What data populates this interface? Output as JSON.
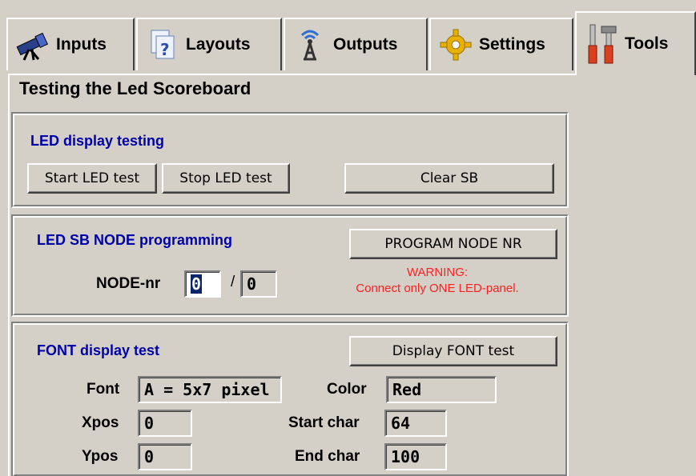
{
  "tabs": [
    {
      "label": "Inputs",
      "icon": "telescope-icon"
    },
    {
      "label": "Layouts",
      "icon": "help-pages-icon"
    },
    {
      "label": "Outputs",
      "icon": "antenna-icon"
    },
    {
      "label": "Settings",
      "icon": "gear-icon"
    },
    {
      "label": "Tools",
      "icon": "tools-icon"
    }
  ],
  "active_tab": "Tools",
  "page_title": "Testing the Led Scoreboard",
  "led_test": {
    "title": "LED display testing",
    "start_label": "Start LED test",
    "stop_label": "Stop LED test",
    "clear_label": "Clear SB"
  },
  "node_prog": {
    "title": "LED SB NODE programming",
    "program_label": "PROGRAM NODE NR",
    "node_label": "NODE-nr",
    "node_value": "0",
    "separator": "/",
    "node_total": "0",
    "warning_line1": "WARNING:",
    "warning_line2": "Connect only ONE LED-panel."
  },
  "font_test": {
    "title": "FONT display test",
    "display_label": "Display FONT test",
    "font_label": "Font",
    "font_value": "A = 5x7 pixel",
    "color_label": "Color",
    "color_value": "Red",
    "xpos_label": "Xpos",
    "xpos_value": "0",
    "ypos_label": "Ypos",
    "ypos_value": "0",
    "start_char_label": "Start char",
    "start_char_value": "64",
    "end_char_label": "End char",
    "end_char_value": "100"
  },
  "colors": {
    "window_bg": "#d4d0c8",
    "group_title": "#0000a8",
    "warning": "#ff2020"
  }
}
